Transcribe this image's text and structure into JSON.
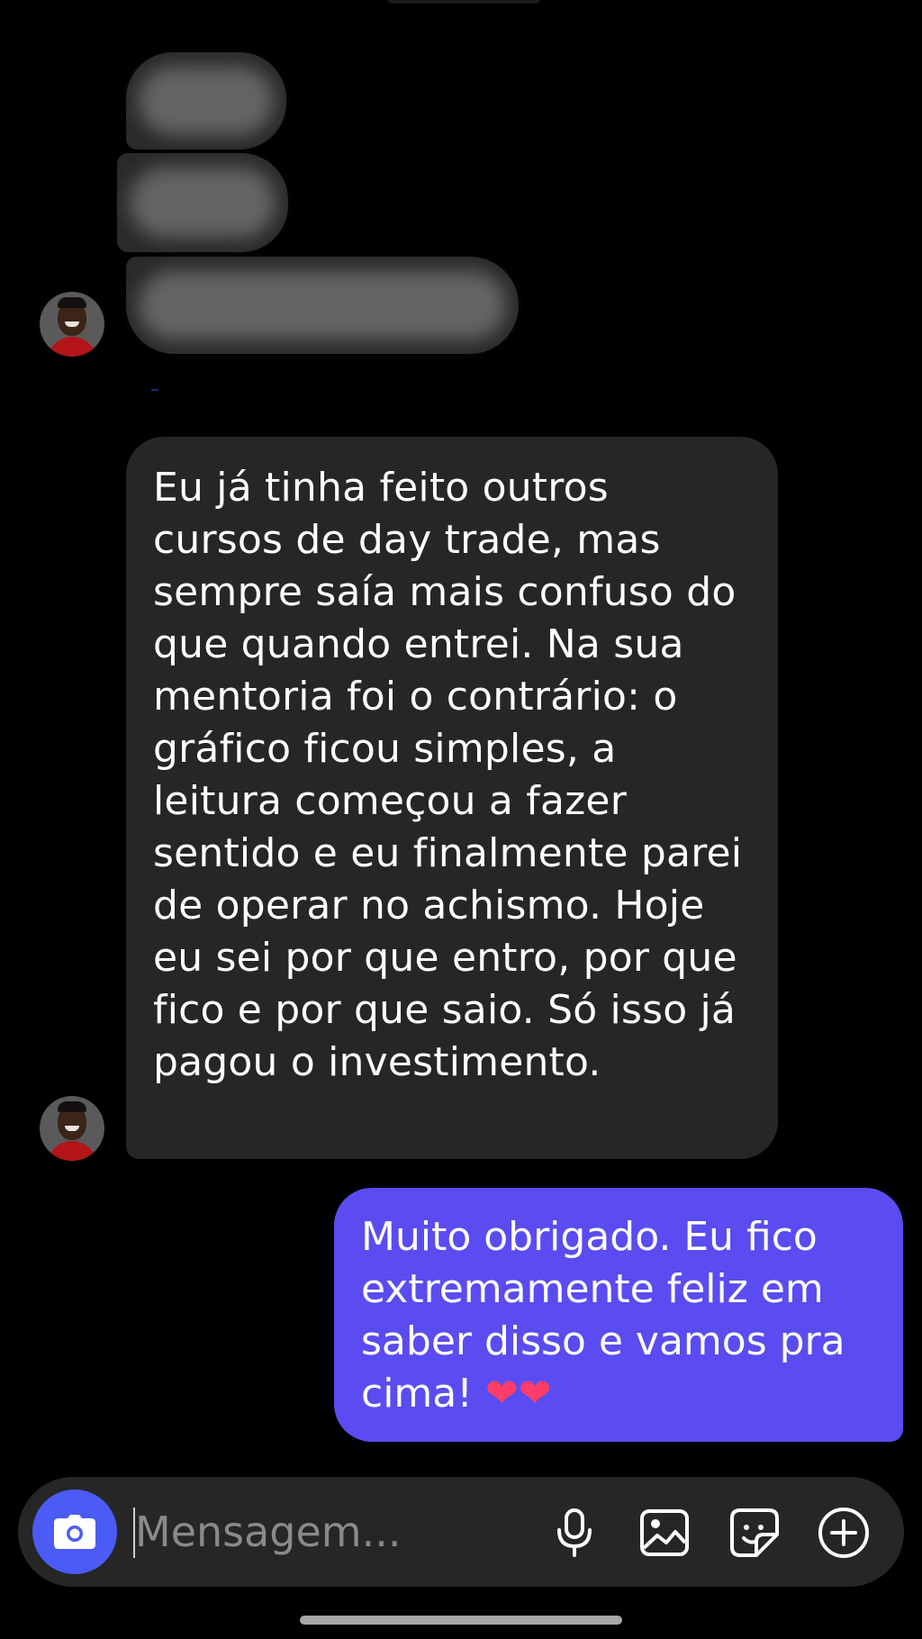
{
  "conversation": {
    "received_message": "Eu já tinha feito outros cursos de day trade, mas sempre saía mais confuso do que quando entrei. Na sua mentoria foi o contrário: o gráfico ficou simples, a leitura começou a fazer sentido e eu finalmente parei de operar no achismo. Hoje eu sei por que entro, por que fico e por que saio. Só isso já pagou o investimento.",
    "sent_message": "Muito obrigado. Eu fico extremamente feliz em saber disso e vamos pra cima!",
    "sent_emoji": "❤❤"
  },
  "composer": {
    "placeholder": "Mensagem...",
    "icons": [
      "camera-icon",
      "microphone-icon",
      "gallery-icon",
      "sticker-icon",
      "plus-icon"
    ]
  },
  "colors": {
    "background": "#000000",
    "received_bubble": "#262626",
    "sent_bubble": "#5a4cf0",
    "camera_button": "#4a5cf5"
  }
}
